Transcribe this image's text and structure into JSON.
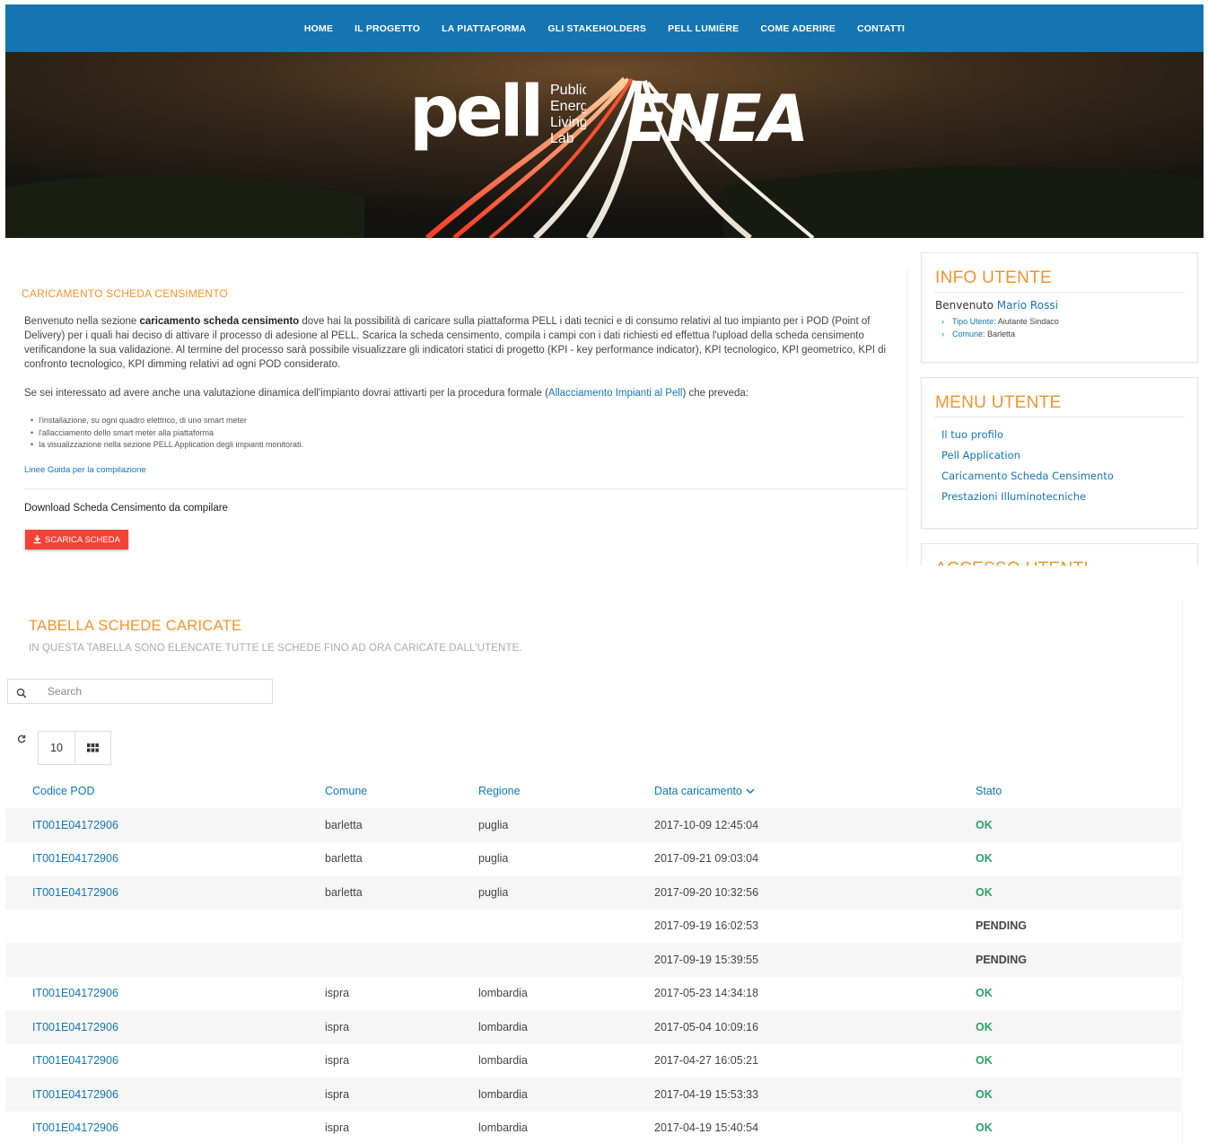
{
  "nav": {
    "items": [
      {
        "label": "HOME"
      },
      {
        "label": "IL PROGETTO"
      },
      {
        "label": "LA PIATTAFORMA"
      },
      {
        "label": "GLI STAKEHOLDERS"
      },
      {
        "label": "PELL LUMIÈRE"
      },
      {
        "label": "COME ADERIRE"
      },
      {
        "label": "CONTATTI"
      }
    ]
  },
  "hero": {
    "logo_pell": "pell",
    "logo_sub": [
      "Public",
      "Energy",
      "Living",
      "Lab"
    ],
    "logo_enea": "ENEA"
  },
  "content": {
    "section_title": "CARICAMENTO SCHEDA CENSIMENTO",
    "p1_intro": "Benvenuto nella sezione ",
    "p1_bold": "caricamento scheda censimento",
    "p1_rest": " dove hai la possibilità di caricare sulla piattaforma PELL i dati tecnici e di consumo relativi al tuo impianto per i POD (Point of Delivery) per i quali hai deciso di attivare il processo di adesione al PELL. Scarica la scheda censimento, compila i campi con i dati richiesti ed effettua l'upload della scheda censimento verificandone la sua validazione. Al termine del processo sarà possibile visualizzare gli indicatori statici di progetto (KPI - key performance indicator), KPI tecnologico, KPI geometrico, KPI di confronto tecnologico, KPI dimming relativi ad ogni POD considerato.",
    "p2_start": "Se sei interessato ad avere anche una valutazione dinamica dell'impianto dovrai attivarti per la procedura formale (",
    "p2_link": "Allacciamento Impianti al Pell",
    "p2_end": ") che preveda:",
    "bullets": [
      "l'installazione, su ogni quadro elettrico, di uno smart meter",
      "l'allacciamento dello smart meter alla piattaforma",
      "la visualizzazione nella sezione PELL Application degli impianti monitorati."
    ],
    "guide_link": "Linee Guida per la compilazione",
    "download_title": "Download Scheda Censimento da compilare",
    "download_button": "SCARICA SCHEDA"
  },
  "sidebar": {
    "info": {
      "title": "INFO UTENTE",
      "welcome": "Benvenuto",
      "user_name": "Mario Rossi",
      "type_label": "Tipo Utente",
      "type_value": "Aiutante Sindaco",
      "comune_label": "Comune",
      "comune_value": "Barletta"
    },
    "menu": {
      "title": "MENU UTENTE",
      "items": [
        {
          "label": "Il tuo profilo"
        },
        {
          "label": "Pell Application"
        },
        {
          "label": "Caricamento Scheda Censimento"
        },
        {
          "label": "Prestazioni Illuminotecniche"
        }
      ]
    },
    "access": {
      "title": "ACCESSO UTENTI"
    }
  },
  "table_section": {
    "title": "TABELLA SCHEDE CARICATE",
    "subtitle": "IN QUESTA TABELLA SONO ELENCATE TUTTE LE SCHEDE FINO AD ORA CARICATE DALL'UTENTE.",
    "search_placeholder": "Search",
    "page_size": "10",
    "columns": [
      "Codice POD",
      "Comune",
      "Regione",
      "Data caricamento",
      "Stato"
    ],
    "rows": [
      {
        "pod": "IT001E04172906",
        "comune": "barletta",
        "regione": "puglia",
        "data": "2017-10-09 12:45:04",
        "stato": "OK"
      },
      {
        "pod": "IT001E04172906",
        "comune": "barletta",
        "regione": "puglia",
        "data": "2017-09-21 09:03:04",
        "stato": "OK"
      },
      {
        "pod": "IT001E04172906",
        "comune": "barletta",
        "regione": "puglia",
        "data": "2017-09-20 10:32:56",
        "stato": "OK"
      },
      {
        "pod": "",
        "comune": "",
        "regione": "",
        "data": "2017-09-19 16:02:53",
        "stato": "PENDING"
      },
      {
        "pod": "",
        "comune": "",
        "regione": "",
        "data": "2017-09-19 15:39:55",
        "stato": "PENDING"
      },
      {
        "pod": "IT001E04172906",
        "comune": "ispra",
        "regione": "lombardia",
        "data": "2017-05-23 14:34:18",
        "stato": "OK"
      },
      {
        "pod": "IT001E04172906",
        "comune": "ispra",
        "regione": "lombardia",
        "data": "2017-05-04 10:09:16",
        "stato": "OK"
      },
      {
        "pod": "IT001E04172906",
        "comune": "ispra",
        "regione": "lombardia",
        "data": "2017-04-27 16:05:21",
        "stato": "OK"
      },
      {
        "pod": "IT001E04172906",
        "comune": "ispra",
        "regione": "lombardia",
        "data": "2017-04-19 15:53:33",
        "stato": "OK"
      },
      {
        "pod": "IT001E04172906",
        "comune": "ispra",
        "regione": "lombardia",
        "data": "2017-04-19 15:40:54",
        "stato": "OK"
      }
    ]
  },
  "colors": {
    "nav_bg": "#1475b2",
    "accent_orange": "#f0932f",
    "link_blue": "#1475b2",
    "button_red": "#f44336",
    "status_ok": "#2e9e6a"
  }
}
